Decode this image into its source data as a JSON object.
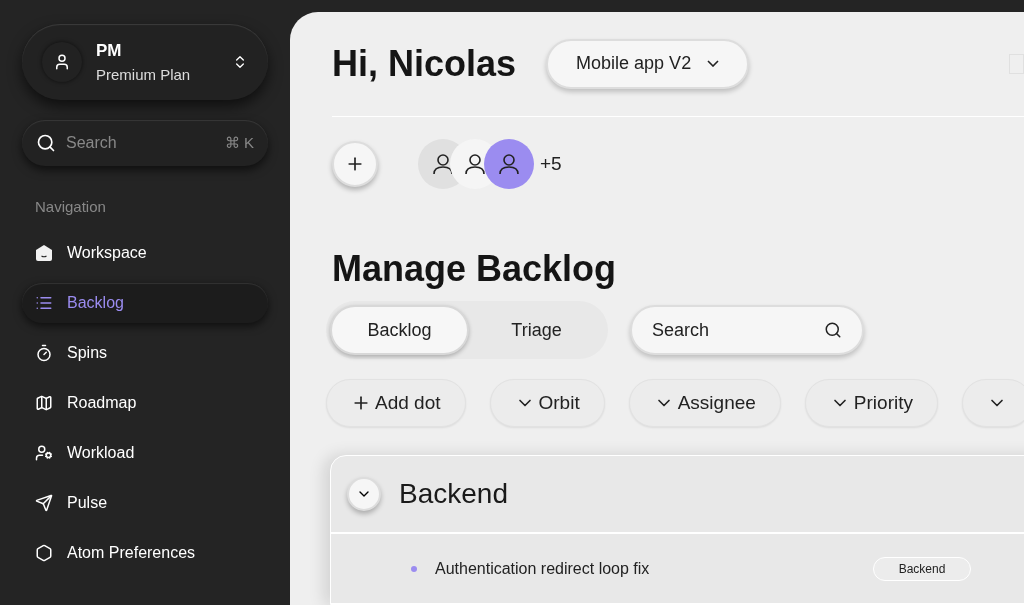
{
  "account": {
    "initials": "PM",
    "plan": "Premium Plan"
  },
  "sidebar_search": {
    "placeholder": "Search",
    "shortcut": "⌘ K"
  },
  "navigation": {
    "heading": "Navigation",
    "items": [
      {
        "label": "Workspace",
        "selected": false
      },
      {
        "label": "Backlog",
        "selected": true
      },
      {
        "label": "Spins",
        "selected": false
      },
      {
        "label": "Roadmap",
        "selected": false
      },
      {
        "label": "Workload",
        "selected": false
      },
      {
        "label": "Pulse",
        "selected": false
      },
      {
        "label": "Atom Preferences",
        "selected": false
      }
    ]
  },
  "header": {
    "greeting": "Hi, Nicolas",
    "project": "Mobile app V2",
    "checked": false
  },
  "members": {
    "more": "+5"
  },
  "page_title": "Manage Backlog",
  "tabs": [
    {
      "label": "Backlog",
      "selected": true
    },
    {
      "label": "Triage",
      "selected": false
    }
  ],
  "search": {
    "placeholder": "Search"
  },
  "filters": [
    {
      "kind": "add",
      "label": "Add dot"
    },
    {
      "kind": "dropdown",
      "label": "Orbit"
    },
    {
      "kind": "dropdown",
      "label": "Assignee"
    },
    {
      "kind": "dropdown",
      "label": "Priority"
    },
    {
      "kind": "dropdown"
    }
  ],
  "group": {
    "title": "Backend",
    "expanded": true,
    "rows": [
      {
        "title": "Authentication redirect loop fix",
        "tag": "Backend",
        "color": "#9b8cf0"
      }
    ]
  }
}
